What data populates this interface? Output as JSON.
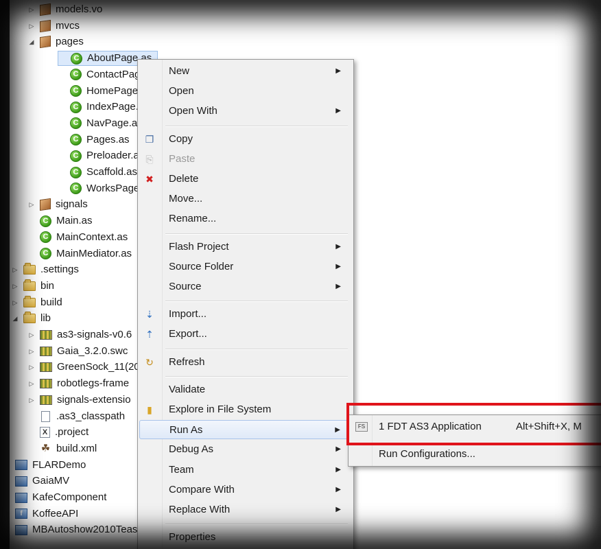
{
  "tree": {
    "items": [
      {
        "label": "models.vo",
        "icon": "package-icon",
        "twisty": "collapsed"
      },
      {
        "label": "mvcs",
        "icon": "package-icon",
        "twisty": "collapsed"
      },
      {
        "label": "pages",
        "icon": "package-icon",
        "twisty": "expanded"
      },
      {
        "label": "AboutPage.as",
        "icon": "class-icon",
        "selected": true
      },
      {
        "label": "ContactPage.as",
        "icon": "class-icon"
      },
      {
        "label": "HomePage.as",
        "icon": "class-icon"
      },
      {
        "label": "IndexPage.as",
        "icon": "class-icon"
      },
      {
        "label": "NavPage.as",
        "icon": "class-icon"
      },
      {
        "label": "Pages.as",
        "icon": "class-icon"
      },
      {
        "label": "Preloader.as",
        "icon": "class-icon"
      },
      {
        "label": "Scaffold.as",
        "icon": "class-icon"
      },
      {
        "label": "WorksPage.as",
        "icon": "class-icon"
      },
      {
        "label": "signals",
        "icon": "package-icon",
        "twisty": "collapsed"
      },
      {
        "label": "Main.as",
        "icon": "class-icon"
      },
      {
        "label": "MainContext.as",
        "icon": "class-icon"
      },
      {
        "label": "MainMediator.as",
        "icon": "class-icon"
      },
      {
        "label": ".settings",
        "icon": "folder-icon",
        "twisty": "collapsed"
      },
      {
        "label": "bin",
        "icon": "folder-icon",
        "twisty": "collapsed"
      },
      {
        "label": "build",
        "icon": "folder-icon",
        "twisty": "collapsed"
      },
      {
        "label": "lib",
        "icon": "folder-icon",
        "twisty": "expanded"
      },
      {
        "label": "as3-signals-v0.6",
        "icon": "library-icon",
        "twisty": "collapsed"
      },
      {
        "label": "Gaia_3.2.0.swc",
        "icon": "library-icon",
        "twisty": "collapsed"
      },
      {
        "label": "GreenSock_11(20",
        "icon": "library-icon",
        "twisty": "collapsed"
      },
      {
        "label": "robotlegs-frame",
        "icon": "library-icon",
        "twisty": "collapsed"
      },
      {
        "label": "signals-extensio",
        "icon": "library-icon",
        "twisty": "collapsed"
      },
      {
        "label": ".as3_classpath",
        "icon": "file-icon"
      },
      {
        "label": ".project",
        "icon": "xml-file-icon"
      },
      {
        "label": "build.xml",
        "icon": "ant-file-icon"
      },
      {
        "label": "FLARDemo",
        "icon": "project-icon"
      },
      {
        "label": "GaiaMV",
        "icon": "project-icon"
      },
      {
        "label": "KafeComponent",
        "icon": "project-icon"
      },
      {
        "label": "KoffeeAPI",
        "icon": "flash-project-icon"
      },
      {
        "label": "MBAutoshow2010Tease",
        "icon": "project-icon"
      }
    ]
  },
  "context_menu": {
    "items": [
      {
        "label": "New",
        "submenu": true
      },
      {
        "label": "Open"
      },
      {
        "label": "Open With",
        "submenu": true
      },
      {
        "separator": true
      },
      {
        "label": "Copy",
        "icon": "copy-icon"
      },
      {
        "label": "Paste",
        "icon": "paste-icon",
        "disabled": true
      },
      {
        "label": "Delete",
        "icon": "delete-icon"
      },
      {
        "label": "Move..."
      },
      {
        "label": "Rename..."
      },
      {
        "separator": true
      },
      {
        "label": "Flash Project",
        "submenu": true
      },
      {
        "label": "Source Folder",
        "submenu": true
      },
      {
        "label": "Source",
        "submenu": true
      },
      {
        "separator": true
      },
      {
        "label": "Import...",
        "icon": "import-icon"
      },
      {
        "label": "Export...",
        "icon": "export-icon"
      },
      {
        "separator": true
      },
      {
        "label": "Refresh",
        "icon": "refresh-icon"
      },
      {
        "separator": true
      },
      {
        "label": "Validate"
      },
      {
        "label": "Explore in File System",
        "icon": "explore-icon"
      },
      {
        "label": "Run As",
        "submenu": true,
        "hover": true
      },
      {
        "label": "Debug As",
        "submenu": true
      },
      {
        "label": "Team",
        "submenu": true
      },
      {
        "label": "Compare With",
        "submenu": true
      },
      {
        "label": "Replace With",
        "submenu": true
      },
      {
        "separator": true
      },
      {
        "label": "Properties"
      }
    ]
  },
  "run_as_submenu": {
    "items": [
      {
        "label": "1 FDT AS3 Application",
        "accelerator": "Alt+Shift+X, M",
        "icon": "fdt-app-icon",
        "icon_text": "FS"
      },
      {
        "label": "Run Configurations..."
      }
    ]
  },
  "colors": {
    "highlight_box": "#e0141b",
    "selection": "#dbe9fb",
    "menu_background": "#f0f0f0"
  }
}
